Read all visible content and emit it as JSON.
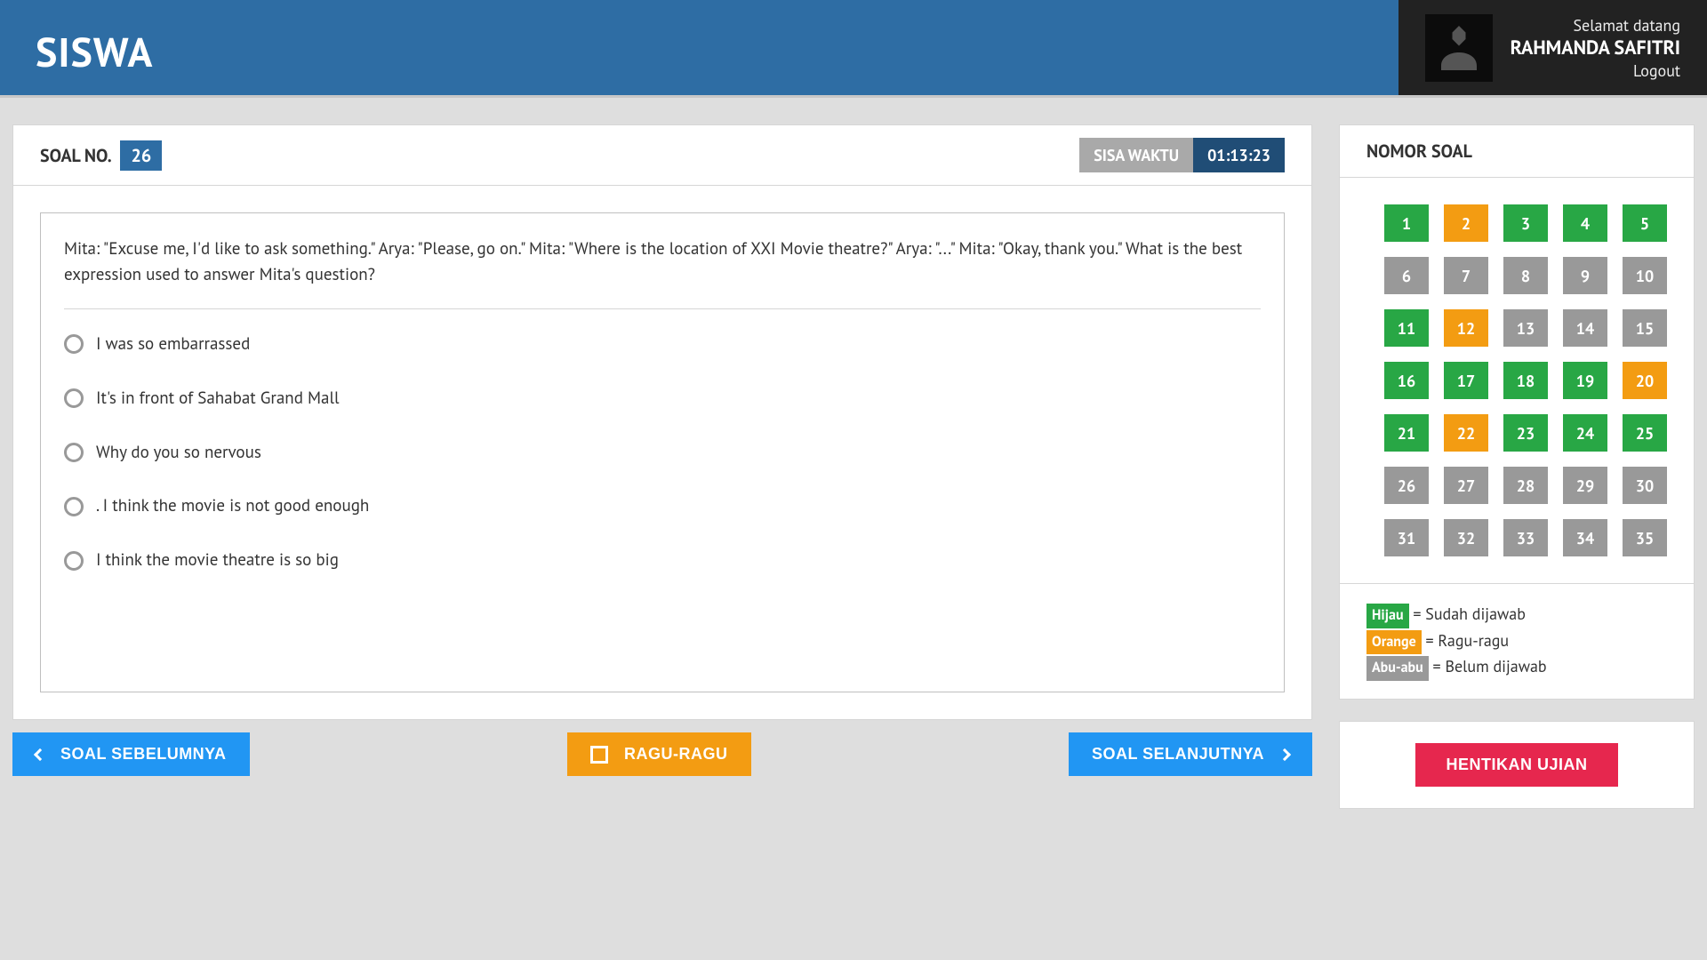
{
  "header": {
    "app_title": "SISWA",
    "welcome": "Selamat datang",
    "user_name": "RAHMANDA SAFITRI",
    "logout": "Logout"
  },
  "question_header": {
    "label": "SOAL NO.",
    "number": "26",
    "timer_label": "SISA WAKTU",
    "timer_value": "01:13:23"
  },
  "question": {
    "text": "Mita: \"Excuse me, I'd like to ask something.\" Arya: \"Please, go on.\" Mita: \"Where is the location of XXI Movie theatre?\" Arya: \"...\" Mita: \"Okay, thank you.\" What is the best expression used to answer Mita's question?",
    "options": [
      "I was so embarrassed",
      "It's in front of Sahabat Grand Mall",
      "Why do you so nervous",
      ". I think the movie is not good enough",
      "I think the movie theatre is so big"
    ]
  },
  "nav": {
    "prev": "SOAL SEBELUMNYA",
    "ragu": "RAGU-RAGU",
    "next": "SOAL SELANJUTNYA"
  },
  "sidebar": {
    "title": "NOMOR SOAL",
    "cells": [
      {
        "n": "1",
        "state": "green"
      },
      {
        "n": "2",
        "state": "orange"
      },
      {
        "n": "3",
        "state": "green"
      },
      {
        "n": "4",
        "state": "green"
      },
      {
        "n": "5",
        "state": "green"
      },
      {
        "n": "6",
        "state": "gray"
      },
      {
        "n": "7",
        "state": "gray"
      },
      {
        "n": "8",
        "state": "gray"
      },
      {
        "n": "9",
        "state": "gray"
      },
      {
        "n": "10",
        "state": "gray"
      },
      {
        "n": "11",
        "state": "green"
      },
      {
        "n": "12",
        "state": "orange"
      },
      {
        "n": "13",
        "state": "gray"
      },
      {
        "n": "14",
        "state": "gray"
      },
      {
        "n": "15",
        "state": "gray"
      },
      {
        "n": "16",
        "state": "green"
      },
      {
        "n": "17",
        "state": "green"
      },
      {
        "n": "18",
        "state": "green"
      },
      {
        "n": "19",
        "state": "green"
      },
      {
        "n": "20",
        "state": "orange"
      },
      {
        "n": "21",
        "state": "green"
      },
      {
        "n": "22",
        "state": "orange"
      },
      {
        "n": "23",
        "state": "green"
      },
      {
        "n": "24",
        "state": "green"
      },
      {
        "n": "25",
        "state": "green"
      },
      {
        "n": "26",
        "state": "gray"
      },
      {
        "n": "27",
        "state": "gray"
      },
      {
        "n": "28",
        "state": "gray"
      },
      {
        "n": "29",
        "state": "gray"
      },
      {
        "n": "30",
        "state": "gray"
      },
      {
        "n": "31",
        "state": "gray"
      },
      {
        "n": "32",
        "state": "gray"
      },
      {
        "n": "33",
        "state": "gray"
      },
      {
        "n": "34",
        "state": "gray"
      },
      {
        "n": "35",
        "state": "gray"
      }
    ],
    "legend": {
      "green_label": "Hijau",
      "green_desc": " = Sudah dijawab",
      "orange_label": "Orange",
      "orange_desc": " = Ragu-ragu",
      "gray_label": "Abu-abu",
      "gray_desc": " = Belum dijawab"
    },
    "stop": "HENTIKAN UJIAN"
  }
}
